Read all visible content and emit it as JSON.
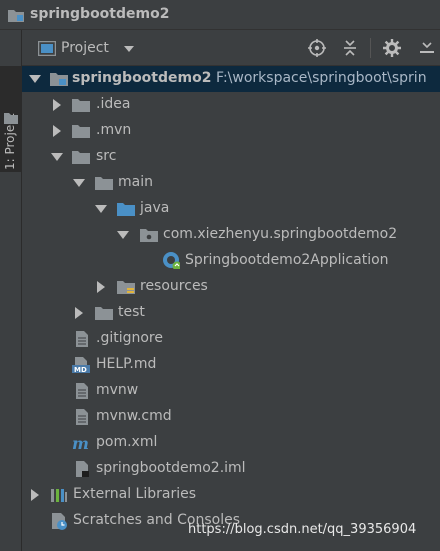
{
  "window": {
    "title": "springbootdemo2",
    "icon": "project-icon"
  },
  "side_tab": {
    "label": "1: Project"
  },
  "panel": {
    "title": "Project",
    "toolbar_icons": [
      "target-icon",
      "collapse-icon",
      "gear-icon",
      "hide-icon"
    ]
  },
  "tree": [
    {
      "label": "springbootdemo2",
      "path": "F:\\workspace\\springboot\\sprin",
      "icon": "module-folder-icon",
      "expanded": true,
      "bold": true,
      "selected": true
    },
    {
      "label": ".idea",
      "icon": "folder-icon",
      "expanded": false
    },
    {
      "label": ".mvn",
      "icon": "folder-icon",
      "expanded": false
    },
    {
      "label": "src",
      "icon": "folder-icon",
      "expanded": true
    },
    {
      "label": "main",
      "icon": "folder-icon",
      "expanded": true
    },
    {
      "label": "java",
      "icon": "source-folder-icon",
      "expanded": true
    },
    {
      "label": "com.xiezhenyu.springbootdemo2",
      "icon": "package-icon",
      "expanded": true
    },
    {
      "label": "Springbootdemo2Application",
      "icon": "spring-boot-class-icon"
    },
    {
      "label": "resources",
      "icon": "resources-folder-icon",
      "expanded": false
    },
    {
      "label": "test",
      "icon": "folder-icon",
      "expanded": false
    },
    {
      "label": ".gitignore",
      "icon": "text-file-icon"
    },
    {
      "label": "HELP.md",
      "icon": "markdown-file-icon"
    },
    {
      "label": "mvnw",
      "icon": "text-file-icon"
    },
    {
      "label": "mvnw.cmd",
      "icon": "text-file-icon"
    },
    {
      "label": "pom.xml",
      "icon": "maven-icon"
    },
    {
      "label": "springbootdemo2.iml",
      "icon": "iml-file-icon"
    },
    {
      "label": "External Libraries",
      "icon": "libraries-icon",
      "expanded": false
    },
    {
      "label": "Scratches and Consoles",
      "icon": "scratches-icon"
    }
  ],
  "watermark": "https://blog.csdn.net/qq_39356904",
  "colors": {
    "background": "#3c3f41",
    "selection": "#0d293e",
    "text": "#bbbbbb",
    "folder": "#8c9296",
    "source_folder": "#4a90c6",
    "spring": "#6cb33f"
  }
}
